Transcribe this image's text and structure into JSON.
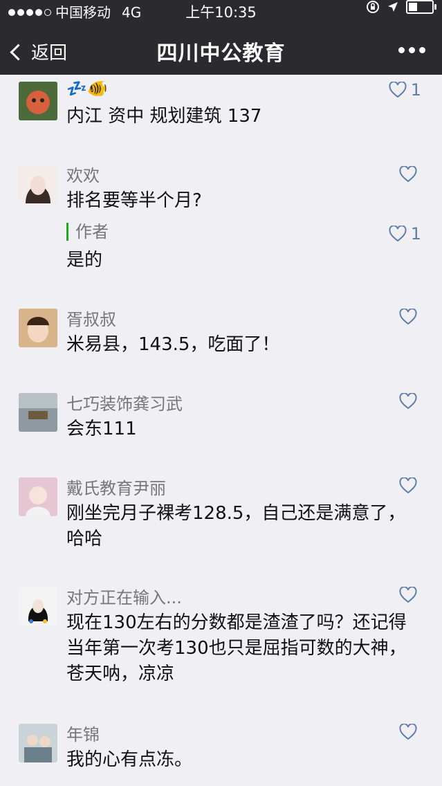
{
  "status": {
    "carrier": "中国移动",
    "network": "4G",
    "time": "上午10:35"
  },
  "nav": {
    "back_label": "返回",
    "title": "四川中公教育"
  },
  "comments": [
    {
      "name": "💤🐠",
      "text": "内江 资中 规划建筑 137",
      "likes": "1",
      "avatar_color": "#c9563a"
    },
    {
      "name": "欢欢",
      "text": "排名要等半个月?",
      "likes": "",
      "avatar_color": "#e8d6cf",
      "reply": {
        "tag": "作者",
        "text": "是的",
        "likes": "1"
      }
    },
    {
      "name": "胥叔叔",
      "text": "米易县，143.5，吃面了！",
      "likes": "",
      "avatar_color": "#d9b48a"
    },
    {
      "name": "七巧装饰龚习武",
      "text": "会东111",
      "likes": "",
      "avatar_color": "#7d8a8f"
    },
    {
      "name": "戴氏教育尹丽",
      "text": "刚坐完月子裸考128.5，自己还是满意了，哈哈",
      "likes": "",
      "avatar_color": "#e6c6d3"
    },
    {
      "name": "对方正在输入...",
      "text": "现在130左右的分数都是渣渣了吗？还记得当年第一次考130也只是屈指可数的大神，苍天呐，凉凉",
      "likes": "",
      "avatar_color": "#f0f0f0"
    },
    {
      "name": "年锦",
      "text": "我的心有点冻。",
      "likes": "",
      "avatar_color": "#9fb0b8"
    }
  ]
}
